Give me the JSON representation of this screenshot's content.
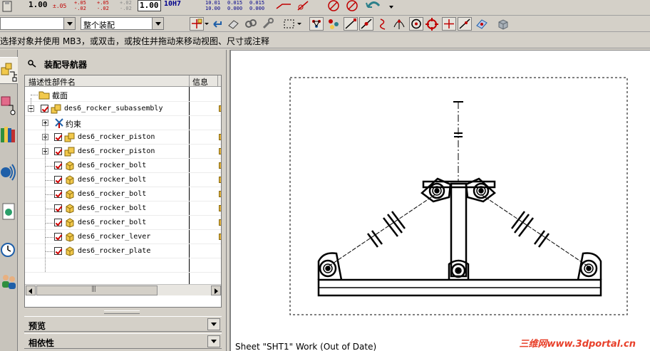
{
  "toolbar1": {
    "value_box_left": "1.00",
    "tol_a": "±.05",
    "tol_b_top": "+.05",
    "tol_b_bot": "-.02",
    "tol_c_top": "+.05",
    "tol_c_bot": "-.02",
    "tol_d_top": "+.02",
    "tol_d_bot": "-.02",
    "value_box_right": "1.00",
    "fit_label": "10H7",
    "fit_a_top": "10.01",
    "fit_a_bot": "10.00",
    "fit_b_top": "0.015",
    "fit_b_bot": "0.000",
    "fit_c_top": "0.015",
    "fit_c_bot": "0.000"
  },
  "toolbar2": {
    "filter_value": "",
    "scope_value": "整个装配"
  },
  "prompt": {
    "text": "选择对象并使用 MB3，或双击，或按住并拖动来移动视图、尺寸或注释"
  },
  "navigator": {
    "title": "装配导航器",
    "columns": [
      "描述性部件名",
      "信息"
    ],
    "rows": [
      {
        "label": "截面",
        "kind": "folder"
      },
      {
        "label": "des6_rocker_subassembly",
        "kind": "assembly"
      },
      {
        "label": "约束",
        "kind": "constraints"
      },
      {
        "label": "des6_rocker_piston",
        "kind": "subassembly"
      },
      {
        "label": "des6_rocker_piston",
        "kind": "subassembly"
      },
      {
        "label": "des6_rocker_bolt",
        "kind": "part"
      },
      {
        "label": "des6_rocker_bolt",
        "kind": "part"
      },
      {
        "label": "des6_rocker_bolt",
        "kind": "part"
      },
      {
        "label": "des6_rocker_bolt",
        "kind": "part"
      },
      {
        "label": "des6_rocker_bolt",
        "kind": "part"
      },
      {
        "label": "des6_rocker_lever",
        "kind": "part"
      },
      {
        "label": "des6_rocker_plate",
        "kind": "part"
      }
    ],
    "preview_label": "预览",
    "dependency_label": "相依性"
  },
  "graphics": {
    "status": "Sheet \"SHT1\" Work (Out of Date)",
    "watermark": "三维网www.3dportal.cn"
  },
  "colors": {
    "check_red": "#d00000",
    "part_yellow": "#f2c94c",
    "watermark": "#e8402a"
  }
}
